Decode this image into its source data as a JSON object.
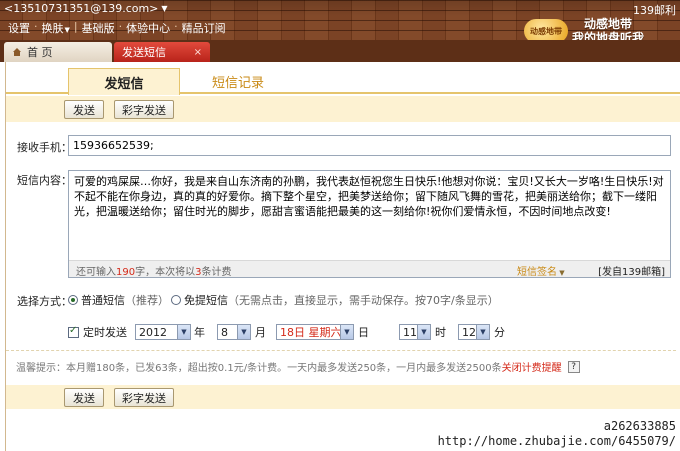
{
  "header": {
    "account": "<13510731351@139.com>",
    "account_right": "139邮利",
    "menu": [
      "设置",
      "换肤",
      "基础版",
      "体验中心",
      "精品订阅"
    ],
    "brand_logo": "动感地带",
    "slogan_line1": "动感地带",
    "slogan_line2": "我的地盘听我"
  },
  "window_tabs": {
    "home": "首 页",
    "sms": "发送短信",
    "close": "×"
  },
  "subtabs": {
    "send": "发短信",
    "records": "短信记录"
  },
  "buttons": {
    "send": "发送",
    "mms": "彩字发送"
  },
  "form": {
    "phone_label": "接收手机：",
    "phone_value": "15936652539;",
    "content_label": "短信内容：",
    "content_value": "可爱的鸡屎屎…你好，我是来自山东济南的孙鹏，我代表赵恒祝您生日快乐!他想对你说：宝贝!又长大一岁咯!生日快乐!对不起不能在你身边，真的真的好爱你。摘下整个星空，把美梦送给你；留下随风飞舞的雪花，把美丽送给你；截下一缕阳光，把温暖送给你；留住时光的脚步，愿甜言蜜语能把最美的这一刻给你!祝你们爱情永恒，不因时间地点改变!",
    "count_prefix": "还可输入",
    "count_remaining": "190",
    "count_mid": "字，本次将以",
    "count_msgs": "3",
    "count_suffix": "条计费",
    "signature": "短信签名",
    "from": "[发自139邮箱]",
    "method_label": "选择方式：",
    "method_normal": "普通短信",
    "method_normal_note": "（推荐）",
    "method_free": "免提短信",
    "method_free_note": "（无需点击，直接显示，需手动保存。按70字/条显示）",
    "timed_label": "定时发送",
    "year": "2012",
    "year_unit": "年",
    "month": "8",
    "month_unit": "月",
    "day": "18日 星期六",
    "day_unit": "日",
    "hour": "11",
    "hour_unit": "时",
    "minute": "12",
    "minute_unit": "分"
  },
  "tip": {
    "text": "温馨提示：本月赠180条，已发63条，超出按0.1元/条计费。一天内最多发送250条，一月内最多发送2500条",
    "link": "关闭计费提醒",
    "help": "?"
  },
  "watermark": {
    "line1": "a262633885",
    "line2": "http://home.zhubajie.com/6455079/"
  }
}
